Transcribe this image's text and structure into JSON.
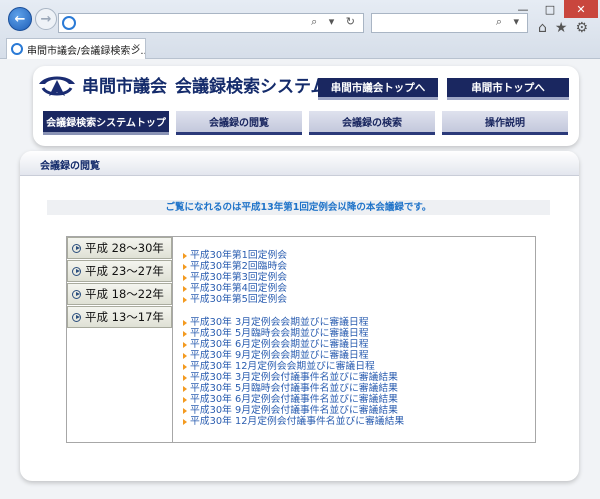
{
  "browser": {
    "tab_title": "串間市議会/会議録検索シ...",
    "tab_close": "×",
    "address_controls": "⌕ ▾ ↻",
    "search_controls": "⌕ ▾",
    "window_min": "—",
    "window_max": "□",
    "window_close": "✕",
    "tools": {
      "home": "⌂",
      "favorites": "★",
      "settings": "⚙"
    }
  },
  "site": {
    "title": "串間市議会",
    "subtitle": "会議録検索システム",
    "top_buttons": [
      "串間市議会トップへ",
      "串間市トップへ"
    ],
    "nav_tabs": [
      "会議録検索システムトップ",
      "会議録の閲覧",
      "会議録の検索",
      "操作説明"
    ]
  },
  "content": {
    "section_title": "会議録の閲覧",
    "notice": "ご覧になれるのは平成13年第1回定例会以降の本会議録です。",
    "year_ranges": [
      "平成 28～30年",
      "平成 23～27年",
      "平成 18～22年",
      "平成 13～17年"
    ],
    "session_docs": [
      "平成30年第1回定例会",
      "平成30年第2回臨時会",
      "平成30年第3回定例会",
      "平成30年第4回定例会",
      "平成30年第5回定例会"
    ],
    "schedule_docs": [
      "平成30年 3月定例会会期並びに審議日程",
      "平成30年 5月臨時会会期並びに審議日程",
      "平成30年 6月定例会会期並びに審議日程",
      "平成30年 9月定例会会期並びに審議日程",
      "平成30年 12月定例会会期並びに審議日程",
      "平成30年 3月定例会付議事件名並びに審議結果",
      "平成30年 5月臨時会付議事件名並びに審議結果",
      "平成30年 6月定例会付議事件名並びに審議結果",
      "平成30年 9月定例会付議事件名並びに審議結果",
      "平成30年 12月定例会付議事件名並びに審議結果"
    ]
  }
}
